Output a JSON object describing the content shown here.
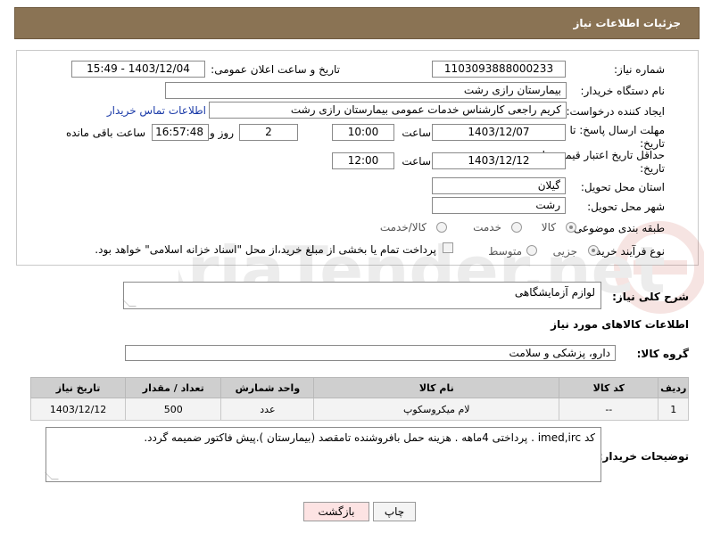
{
  "header": {
    "title": "جزئیات اطلاعات نیاز"
  },
  "fields": {
    "need_number_label": "شماره نیاز:",
    "need_number": "1103093888000233",
    "announce_label": "تاریخ و ساعت اعلان عمومی:",
    "announce_value": "1403/12/04 - 15:49",
    "buyer_org_label": "نام دستگاه خریدار:",
    "buyer_org": "بیمارستان رازی رشت",
    "creator_label": "ایجاد کننده درخواست:",
    "creator": "کریم راجعی کارشناس خدمات عمومی بیمارستان رازی رشت",
    "contact_link": "اطلاعات تماس خریدار",
    "deadline_label_1": "مهلت ارسال پاسخ: تا",
    "deadline_label_2": "تاریخ:",
    "deadline_date": "1403/12/07",
    "time_label": "ساعت",
    "deadline_time": "10:00",
    "days_value": "2",
    "days_label": "روز و",
    "remaining_time": "16:57:48",
    "remaining_label": "ساعت باقی مانده",
    "validity_label_1": "حداقل تاریخ اعتبار قیمت: تا",
    "validity_label_2": "تاریخ:",
    "validity_date": "1403/12/12",
    "validity_time": "12:00",
    "province_label": "استان محل تحویل:",
    "province": "گیلان",
    "city_label": "شهر محل تحویل:",
    "city": "رشت",
    "category_label": "طبقه بندی موضوعی:",
    "cat_goods": "کالا",
    "cat_service": "خدمت",
    "cat_goods_service": "کالا/خدمت",
    "process_label": "نوع فرآیند خرید :",
    "proc_partial": "جزیی",
    "proc_medium": "متوسط",
    "payment_note": "پرداخت تمام یا بخشی از مبلغ خرید،از محل \"اسناد خزانه اسلامی\" خواهد بود."
  },
  "description": {
    "label": "شرح کلی نیاز:",
    "value": "لوازم آزمایشگاهی"
  },
  "goods_info_title": "اطلاعات کالاهای مورد نیاز",
  "goods_group": {
    "label": "گروه کالا:",
    "value": "دارو، پزشکی و سلامت"
  },
  "table": {
    "headers": [
      "ردیف",
      "کد کالا",
      "نام کالا",
      "واحد شمارش",
      "تعداد / مقدار",
      "تاریخ نیاز"
    ],
    "rows": [
      [
        "1",
        "--",
        "لام میکروسکوپ",
        "عدد",
        "500",
        "1403/12/12"
      ]
    ]
  },
  "buyer_notes": {
    "label": "توضیحات خریدار:",
    "value": "کد imed,irc . پرداختی 4ماهه . هزینه حمل بافروشنده تامقصد (بیمارستان ).پیش فاکتور ضمیمه گردد."
  },
  "buttons": {
    "print": "چاپ",
    "back": "بازگشت"
  },
  "watermark": "AriaTender.net",
  "colors": {
    "header_bg": "#8a7354",
    "link": "#1a3aa8",
    "table_header": "#cfcfcf"
  }
}
